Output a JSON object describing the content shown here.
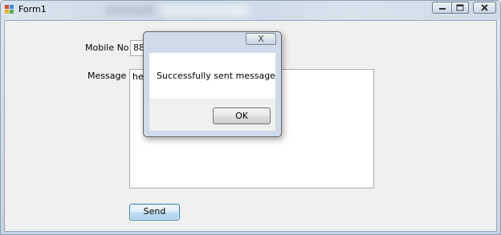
{
  "window": {
    "title": "Form1"
  },
  "form": {
    "mobile_label": "Mobile No :",
    "mobile_value": "880",
    "message_label": "Message :",
    "message_value": "hello",
    "send_label": "Send"
  },
  "dialog": {
    "close_glyph": "X",
    "text": "Successfully sent message",
    "ok_label": "OK"
  },
  "icons": {
    "minimize": "minimize-icon",
    "maximize": "maximize-icon",
    "close": "close-icon",
    "app": "form-icon"
  }
}
